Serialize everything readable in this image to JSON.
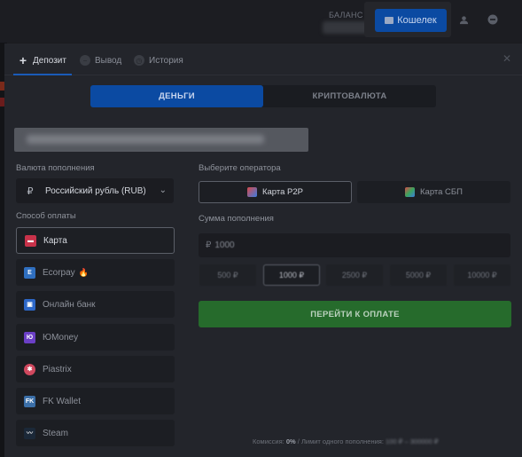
{
  "topbar": {
    "balance_label": "БАЛАНС ▾",
    "wallet_button": "Кошелек",
    "icons": [
      "user-icon",
      "minus-circle-icon"
    ]
  },
  "modal": {
    "tabs": [
      {
        "label": "Депозит",
        "icon": "plus-icon",
        "active": true
      },
      {
        "label": "Вывод",
        "icon": "minus-icon",
        "active": false
      },
      {
        "label": "История",
        "icon": "clock-icon",
        "active": false
      }
    ],
    "close_icon": "close-icon",
    "currency_type": {
      "money": "ДЕНЬГИ",
      "crypto": "КРИПТОВАЛЮТА",
      "selected": "money"
    },
    "left": {
      "currency_label": "Валюта пополнения",
      "currency_value": "Российский рубль (RUB)",
      "currency_symbol": "₽",
      "method_label": "Способ оплаты",
      "methods": [
        {
          "label": "Карта",
          "icon": "card-icon",
          "color": "#c8324a",
          "active": true
        },
        {
          "label": "Ecorpay",
          "icon": "ecorpay-icon",
          "color": "#2f6fc0",
          "active": false,
          "badge": "🔥"
        },
        {
          "label": "Онлайн банк",
          "icon": "bank-icon",
          "color": "#2d67c7",
          "active": false
        },
        {
          "label": "ЮMoney",
          "icon": "yoomoney-icon",
          "color": "#6b3fc6",
          "active": false
        },
        {
          "label": "Piastrix",
          "icon": "piastrix-icon",
          "color": "#d0485e",
          "active": false
        },
        {
          "label": "FK Wallet",
          "icon": "fkwallet-icon",
          "color": "#3b6fa8",
          "active": false
        },
        {
          "label": "Steam",
          "icon": "steam-icon",
          "color": "#1b2838",
          "active": false
        }
      ]
    },
    "right": {
      "operator_label": "Выберите оператора",
      "operators": [
        {
          "label": "Карта P2P",
          "icon": "p2p-card-icon",
          "active": true
        },
        {
          "label": "Карта СБП",
          "icon": "sbp-icon",
          "active": false
        }
      ],
      "amount_label": "Сумма пополнения",
      "amount_symbol": "₽",
      "amount_value": "1000",
      "presets": [
        {
          "label": "500 ₽",
          "active": false
        },
        {
          "label": "1000 ₽",
          "active": true
        },
        {
          "label": "2500 ₽",
          "active": false
        },
        {
          "label": "5000 ₽",
          "active": false
        },
        {
          "label": "10000 ₽",
          "active": false
        }
      ],
      "submit": "ПЕРЕЙТИ К ОПЛАТЕ",
      "footer_commission_label": "Комиссия:",
      "footer_commission_value": "0%",
      "footer_sep": "/",
      "footer_limit_label": "Лимит одного пополнения:",
      "footer_limit_value": "100 ₽ – 300000 ₽"
    }
  },
  "colors": {
    "accent_blue": "#0b4aa2",
    "accent_green": "#266b2c",
    "modal_bg": "#23252b",
    "page_bg": "#1a1b1f"
  }
}
